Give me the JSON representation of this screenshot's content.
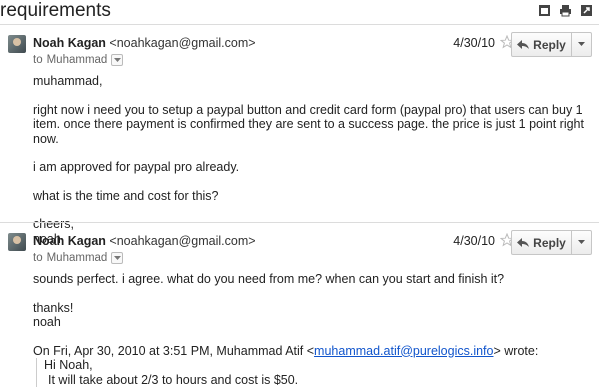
{
  "subject": "requirements",
  "top_icons": [
    "new-window-icon",
    "print-icon",
    "popout-icon"
  ],
  "messages": [
    {
      "sender": "Noah Kagan",
      "email": "<noahkagan@gmail.com>",
      "to_prefix": "to",
      "recipient": "Muhammad",
      "date": "4/30/10",
      "reply_label": "Reply",
      "body": [
        "muhammad,",
        "right now i need you to setup a paypal button and credit card form (paypal pro) that users can buy 1 item. once there payment is confirmed they are sent to a success page. the price is just 1 point right now.",
        "i am approved for paypal pro already.",
        "what is the time and cost for this?",
        "cheers,",
        "noah"
      ]
    },
    {
      "sender": "Noah Kagan",
      "email": "<noahkagan@gmail.com>",
      "to_prefix": "to",
      "recipient": "Muhammad",
      "date": "4/30/10",
      "reply_label": "Reply",
      "body": [
        "sounds perfect. i agree. what do you need from me? when can you start and finish it?",
        "thanks!",
        "noah"
      ],
      "quote_header_prefix": "On Fri, Apr 30, 2010 at 3:51 PM, Muhammad Atif <",
      "quote_link": "muhammad.atif@purelogics.info",
      "quote_header_suffix": "> wrote:",
      "quote_lines": [
        "Hi Noah,",
        "It will take about 2/3 to hours and cost is $50."
      ]
    }
  ]
}
